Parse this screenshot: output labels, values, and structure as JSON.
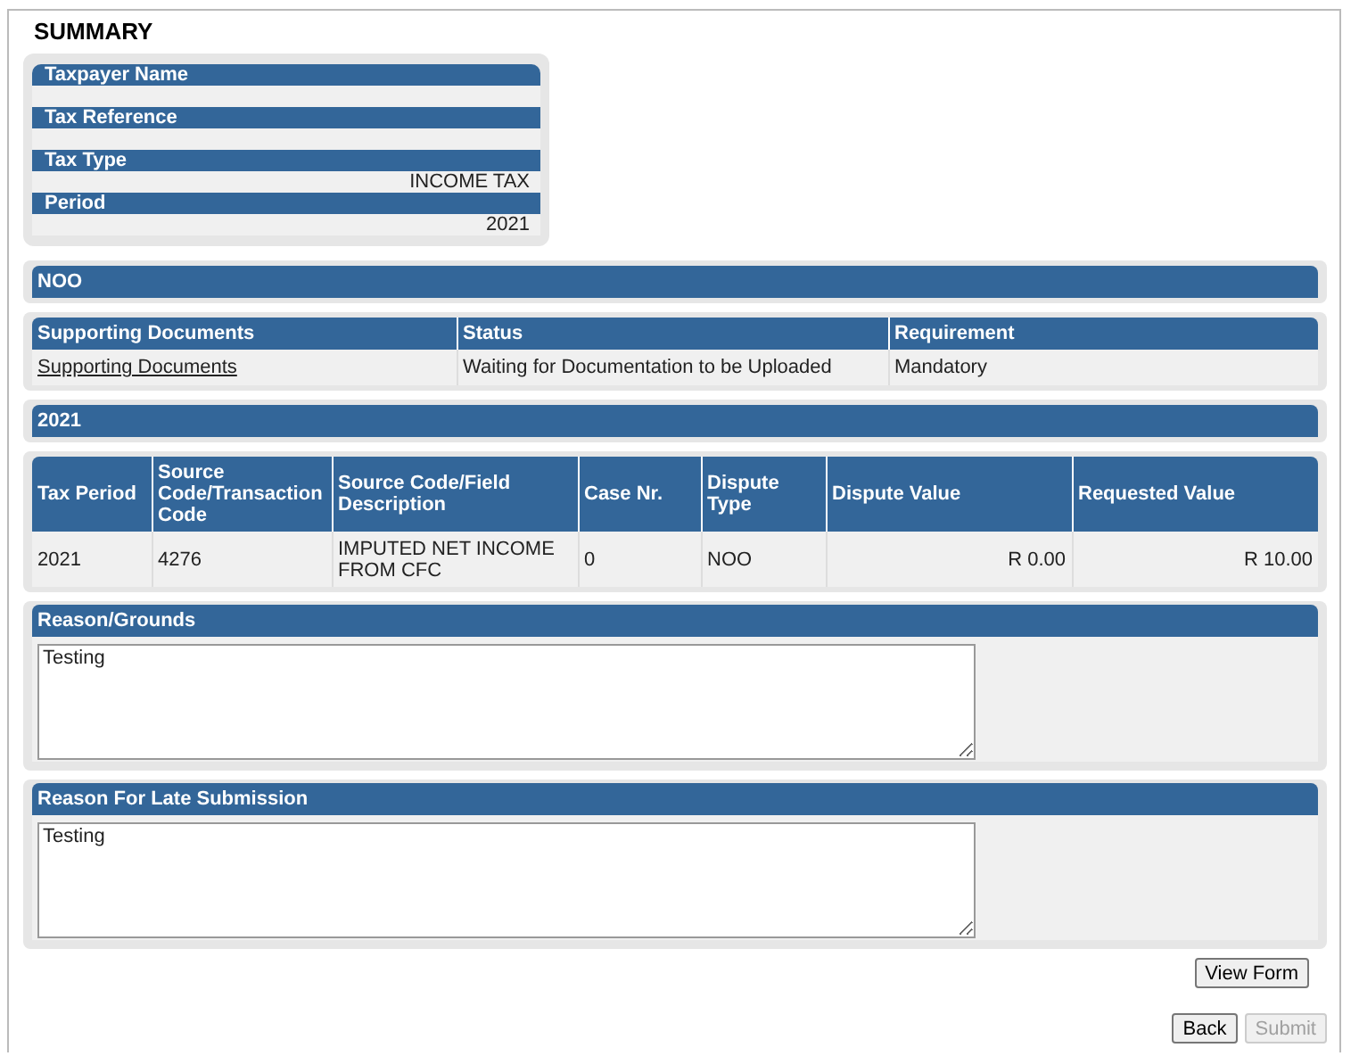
{
  "title": "SUMMARY",
  "summary": [
    {
      "label": "Taxpayer Name"
    },
    {
      "label": "Tax Reference"
    },
    {
      "label": "Tax Type",
      "value": "INCOME TAX"
    },
    {
      "label": "Period",
      "value": "2021"
    }
  ],
  "sections": [
    {
      "kind": "heading",
      "title": "NOO"
    },
    {
      "kind": "documents",
      "columns": [
        "Supporting Documents",
        "Status",
        "Requirement"
      ],
      "rows": [
        [
          {
            "text": "Supporting Documents",
            "kind": "link"
          },
          {
            "text": "Waiting for Documentation to be Uploaded"
          },
          {
            "text": "Mandatory"
          }
        ]
      ]
    },
    {
      "kind": "heading",
      "title": "2021"
    },
    {
      "kind": "transactions",
      "columns": [
        "Tax Period",
        "Source Code/Transaction Code",
        "Source Code/Field Description",
        "Case Nr.",
        "Dispute Type",
        "Dispute Value",
        "Requested Value"
      ],
      "rows": [
        [
          {
            "text": "2021"
          },
          {
            "text": "4276"
          },
          {
            "text": "IMPUTED NET INCOME FROM CFC"
          },
          {
            "text": "0"
          },
          {
            "text": "NOO"
          },
          {
            "text": "R 0.00",
            "kind": "amount"
          },
          {
            "text": "R 10.00",
            "kind": "amount"
          }
        ]
      ]
    },
    {
      "kind": "textbox",
      "title": "Reason/Grounds",
      "value": "Testing"
    },
    {
      "kind": "textbox",
      "title": "Reason For Late Submission",
      "value": "Testing"
    }
  ],
  "view_button": {
    "label": "View Form",
    "disabled": false
  },
  "buttons": [
    {
      "label": "Back",
      "disabled": false
    },
    {
      "label": "Submit",
      "disabled": true
    }
  ]
}
